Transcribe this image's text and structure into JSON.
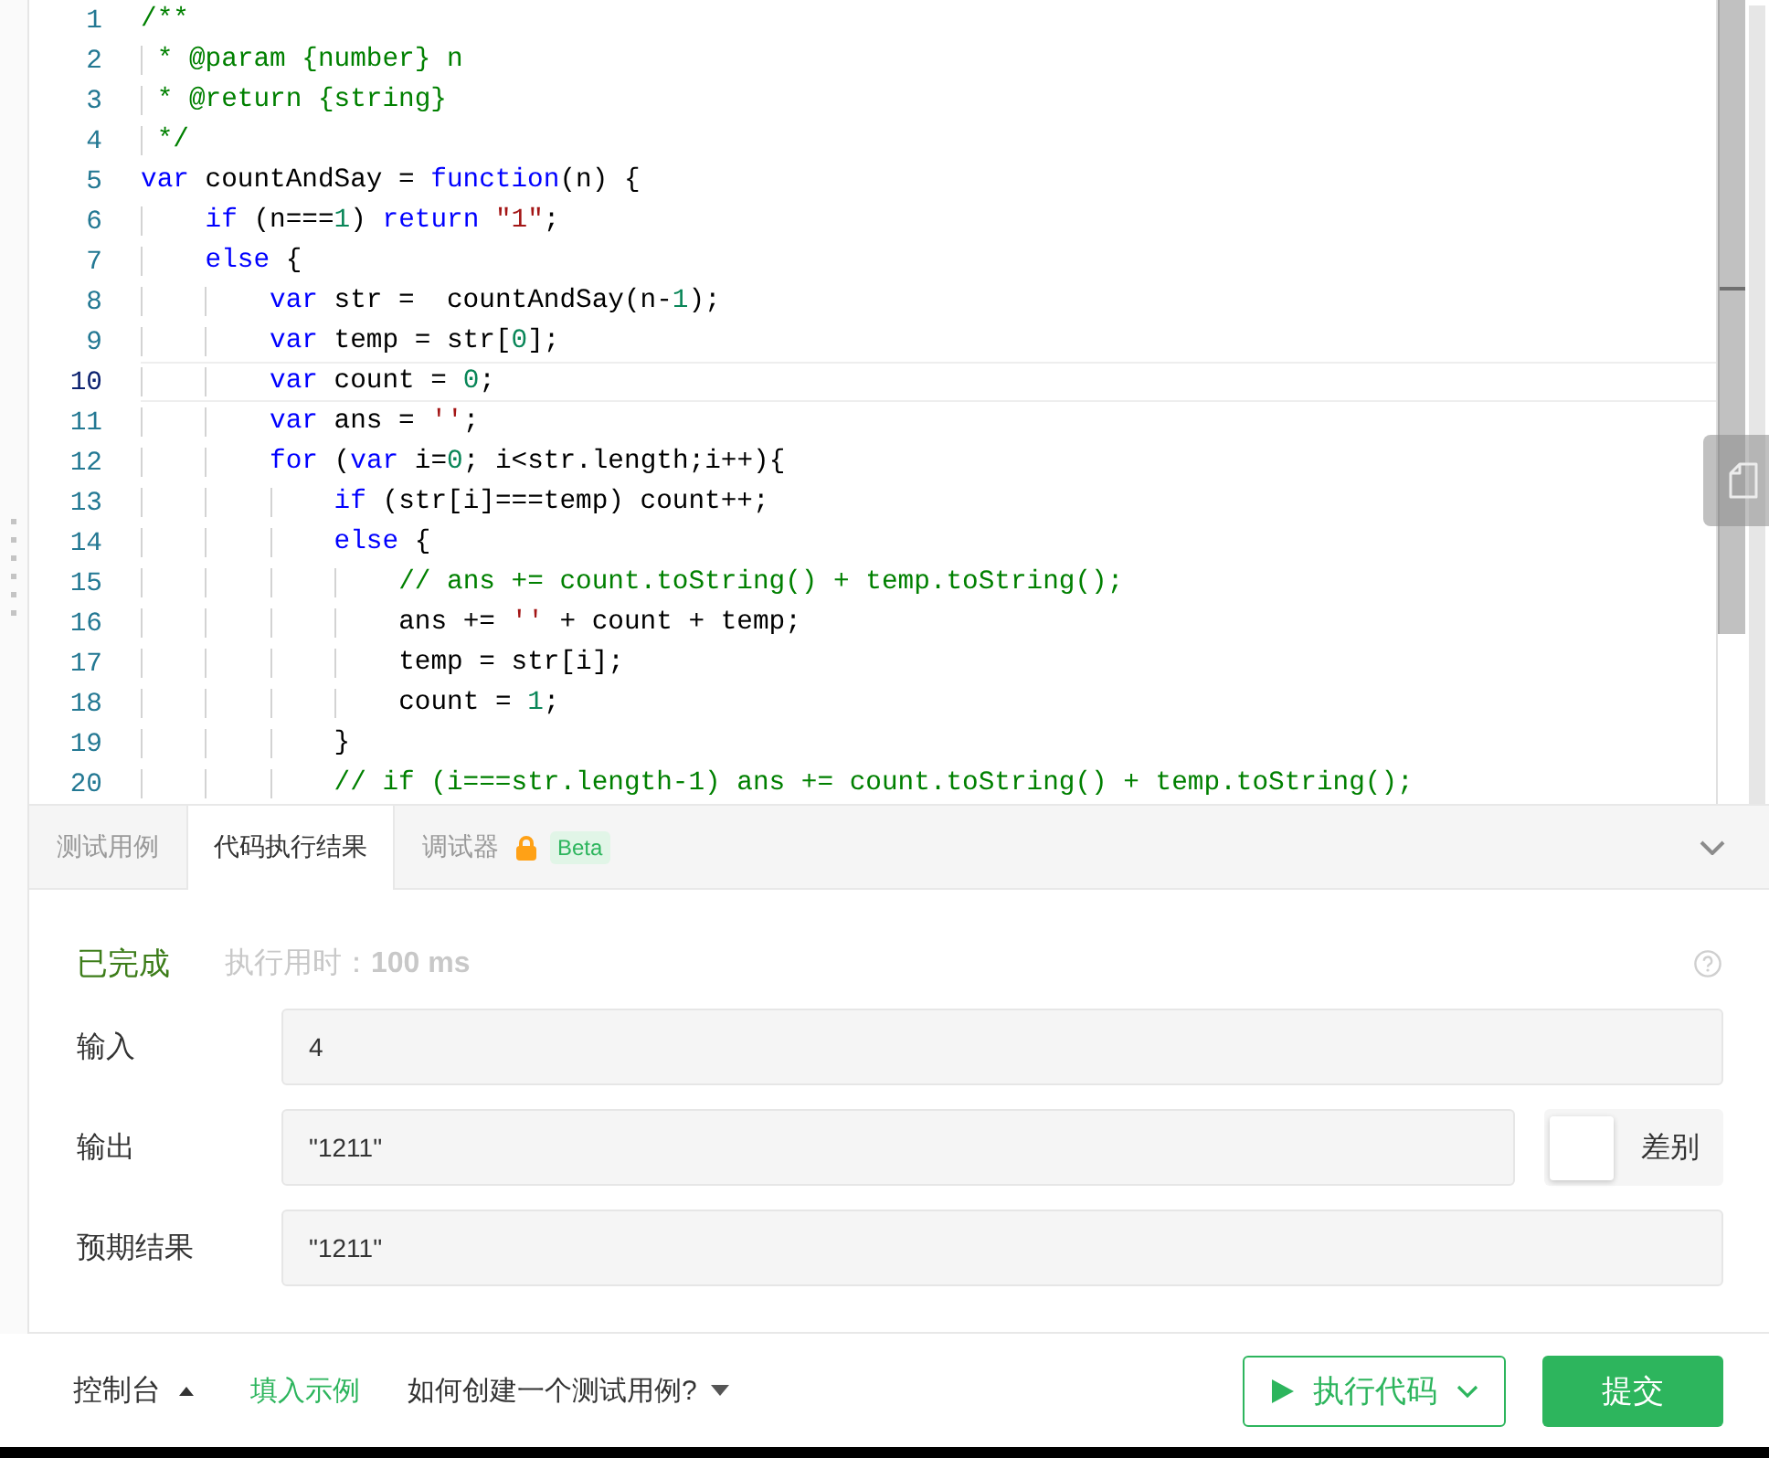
{
  "editor": {
    "lines": [
      {
        "number": "1",
        "current": false,
        "tokens": [
          {
            "kind": "comment",
            "text": "/**"
          }
        ]
      },
      {
        "number": "2",
        "current": false,
        "tokens": [
          {
            "kind": "comment",
            "text": " * @param {number} n"
          }
        ]
      },
      {
        "number": "3",
        "current": false,
        "tokens": [
          {
            "kind": "comment",
            "text": " * @return {string}"
          }
        ]
      },
      {
        "number": "4",
        "current": false,
        "tokens": [
          {
            "kind": "comment",
            "text": " */"
          }
        ]
      },
      {
        "number": "5",
        "current": false,
        "tokens": [
          {
            "kind": "keyword",
            "text": "var"
          },
          {
            "kind": "plain",
            "text": " countAndSay = "
          },
          {
            "kind": "keyword",
            "text": "function"
          },
          {
            "kind": "plain",
            "text": "(n) {"
          }
        ]
      },
      {
        "number": "6",
        "current": false,
        "tokens": [
          {
            "kind": "keyword",
            "text": "    if"
          },
          {
            "kind": "plain",
            "text": " (n==="
          },
          {
            "kind": "number",
            "text": "1"
          },
          {
            "kind": "plain",
            "text": ") "
          },
          {
            "kind": "keyword",
            "text": "return "
          },
          {
            "kind": "string",
            "text": "\"1\""
          },
          {
            "kind": "plain",
            "text": ";"
          }
        ]
      },
      {
        "number": "7",
        "current": false,
        "tokens": [
          {
            "kind": "keyword",
            "text": "    else"
          },
          {
            "kind": "plain",
            "text": " {"
          }
        ]
      },
      {
        "number": "8",
        "current": false,
        "tokens": [
          {
            "kind": "keyword",
            "text": "        var"
          },
          {
            "kind": "plain",
            "text": " str =  countAndSay(n-"
          },
          {
            "kind": "number",
            "text": "1"
          },
          {
            "kind": "plain",
            "text": ");"
          }
        ]
      },
      {
        "number": "9",
        "current": false,
        "tokens": [
          {
            "kind": "keyword",
            "text": "        var"
          },
          {
            "kind": "plain",
            "text": " temp = str["
          },
          {
            "kind": "number",
            "text": "0"
          },
          {
            "kind": "plain",
            "text": "];"
          }
        ]
      },
      {
        "number": "10",
        "current": true,
        "tokens": [
          {
            "kind": "keyword",
            "text": "        var"
          },
          {
            "kind": "plain",
            "text": " count = "
          },
          {
            "kind": "number",
            "text": "0"
          },
          {
            "kind": "plain",
            "text": ";"
          }
        ]
      },
      {
        "number": "11",
        "current": false,
        "tokens": [
          {
            "kind": "keyword",
            "text": "        var"
          },
          {
            "kind": "plain",
            "text": " ans = "
          },
          {
            "kind": "string",
            "text": "''"
          },
          {
            "kind": "plain",
            "text": ";"
          }
        ]
      },
      {
        "number": "12",
        "current": false,
        "tokens": [
          {
            "kind": "keyword",
            "text": "        for"
          },
          {
            "kind": "plain",
            "text": " ("
          },
          {
            "kind": "keyword",
            "text": "var"
          },
          {
            "kind": "plain",
            "text": " i="
          },
          {
            "kind": "number",
            "text": "0"
          },
          {
            "kind": "plain",
            "text": "; i<str.length;i++){"
          }
        ]
      },
      {
        "number": "13",
        "current": false,
        "tokens": [
          {
            "kind": "keyword",
            "text": "            if"
          },
          {
            "kind": "plain",
            "text": " (str[i]===temp) count++;"
          }
        ]
      },
      {
        "number": "14",
        "current": false,
        "tokens": [
          {
            "kind": "keyword",
            "text": "            else"
          },
          {
            "kind": "plain",
            "text": " {"
          }
        ]
      },
      {
        "number": "15",
        "current": false,
        "tokens": [
          {
            "kind": "comment",
            "text": "                // ans += count.toString() + temp.toString();"
          }
        ]
      },
      {
        "number": "16",
        "current": false,
        "tokens": [
          {
            "kind": "plain",
            "text": "                ans += "
          },
          {
            "kind": "string",
            "text": "''"
          },
          {
            "kind": "plain",
            "text": " + count + temp;"
          }
        ]
      },
      {
        "number": "17",
        "current": false,
        "tokens": [
          {
            "kind": "plain",
            "text": "                temp = str[i];"
          }
        ]
      },
      {
        "number": "18",
        "current": false,
        "tokens": [
          {
            "kind": "plain",
            "text": "                count = "
          },
          {
            "kind": "number",
            "text": "1"
          },
          {
            "kind": "plain",
            "text": ";"
          }
        ]
      },
      {
        "number": "19",
        "current": false,
        "tokens": [
          {
            "kind": "plain",
            "text": "            }"
          }
        ]
      },
      {
        "number": "20",
        "current": false,
        "tokens": [
          {
            "kind": "comment",
            "text": "            // if (i===str.length-1) ans += count.toString() + temp.toString();"
          }
        ]
      }
    ]
  },
  "result_panel": {
    "tabs": [
      {
        "label": "测试用例",
        "selected": false,
        "locked": false
      },
      {
        "label": "代码执行结果",
        "selected": true,
        "locked": false
      },
      {
        "label": "调试器",
        "selected": false,
        "locked": true,
        "badge": "Beta"
      }
    ],
    "status": "已完成",
    "runtime": "执行用时：**100 ms**",
    "fields": [
      {
        "label": "输入",
        "value": "4"
      },
      {
        "label": "输出",
        "value": "\"1211\"",
        "diff": {
          "label": "差别",
          "on": false
        }
      },
      {
        "label": "预期结果",
        "value": "\"1211\""
      }
    ]
  },
  "footer": {
    "console": "控制台",
    "fill_example": "填入示例",
    "help": "如何创建一个测试用例?",
    "run_button": "执行代码",
    "submit_button": "提交"
  }
}
